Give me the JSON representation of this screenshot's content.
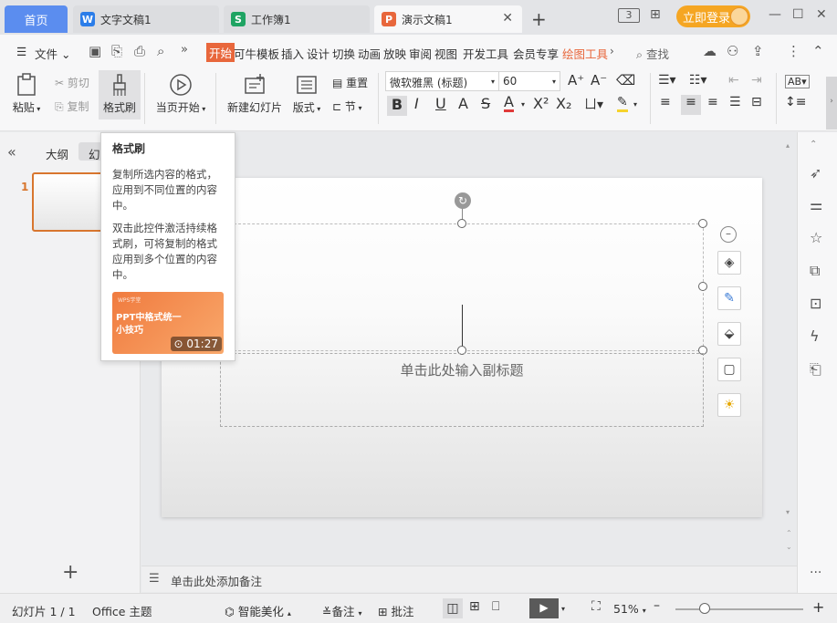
{
  "titlebar": {
    "tabs": [
      {
        "label": "首页"
      },
      {
        "label": "文字文稿1",
        "icon": "W",
        "color": "#2b7de9"
      },
      {
        "label": "工作簿1",
        "icon": "S",
        "color": "#1fa463"
      },
      {
        "label": "演示文稿1",
        "icon": "P",
        "color": "#e8673c"
      }
    ],
    "new_tab": "+",
    "badge": "3",
    "login": "立即登录"
  },
  "menubar": {
    "file": "文件",
    "items": [
      "开始",
      "可牛模板",
      "插入",
      "设计",
      "切换",
      "动画",
      "放映",
      "审阅",
      "视图",
      "开发工具",
      "会员专享",
      "绘图工具"
    ],
    "search": "查找"
  },
  "ribbon": {
    "paste": "粘贴",
    "cut": "剪切",
    "copy": "复制",
    "format_painter": "格式刷",
    "from_current": "当页开始",
    "new_slide": "新建幻灯片",
    "layout": "版式",
    "reset": "重置",
    "section": "节",
    "font_name": "微软雅黑 (标题)",
    "font_size": "60"
  },
  "leftpanel": {
    "outline_tab": "大纲",
    "slides_tab": "幻",
    "slide_number": "1",
    "add": "+"
  },
  "tooltip": {
    "title": "格式刷",
    "para1": "复制所选内容的格式，应用到不同位置的内容中。",
    "para2": "双击此控件激活持续格式刷，可将复制的格式应用到多个位置的内容中。",
    "video_brand": "WPS学堂",
    "video_title": "PPT中格式统一小技巧",
    "video_duration": "01:27"
  },
  "slide": {
    "subtitle_placeholder": "单击此处输入副标题"
  },
  "notes": {
    "placeholder": "单击此处添加备注"
  },
  "statusbar": {
    "slide_info": "幻灯片 1 / 1",
    "theme": "Office 主题",
    "beautify": "智能美化",
    "notes": "备注",
    "comment": "批注",
    "zoom": "51%"
  }
}
